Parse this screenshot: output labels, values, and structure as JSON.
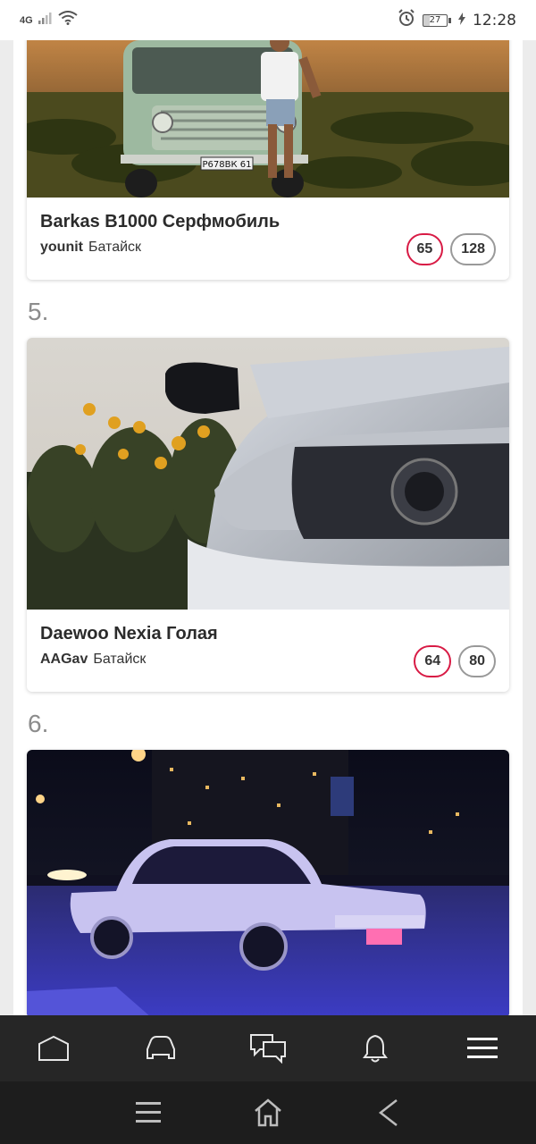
{
  "status_bar": {
    "network": "4G",
    "battery_level": "27",
    "time": "12:28"
  },
  "cards": [
    {
      "title": "Barkas B1000 Серфмобиль",
      "user": "younit",
      "city": "Батайск",
      "score_red": "65",
      "score_gray": "128",
      "plate": "Р678ВК 61"
    },
    {
      "rank": "5.",
      "title": "Daewoo Nexia Голая",
      "user": "AAGav",
      "city": "Батайск",
      "score_red": "64",
      "score_gray": "80"
    },
    {
      "rank": "6."
    }
  ],
  "tab_bar": {
    "items": [
      "home-icon",
      "car-icon",
      "messages-icon",
      "bell-icon",
      "menu-icon"
    ]
  },
  "system_nav": {
    "items": [
      "recent-apps-icon",
      "home-icon",
      "back-icon"
    ]
  },
  "colors": {
    "accent_red": "#d81b45",
    "tab_bar_bg": "#262626",
    "system_nav_bg": "#1d1d1d"
  }
}
